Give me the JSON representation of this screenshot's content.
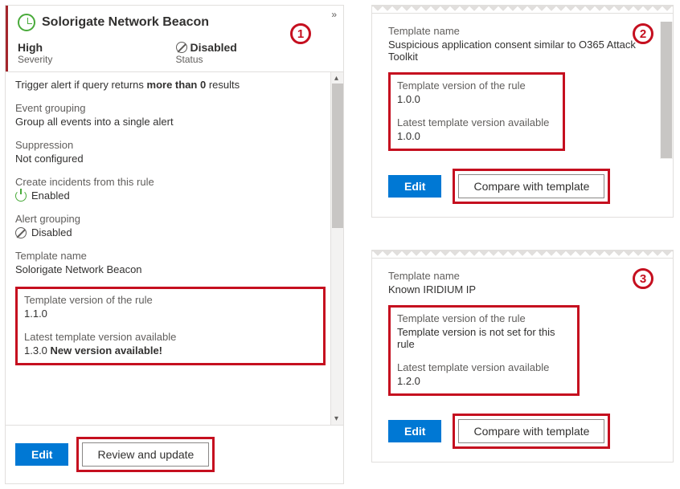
{
  "panel1": {
    "marker": "1",
    "title": "Solorigate Network Beacon",
    "severity_label": "Severity",
    "severity_value": "High",
    "status_label": "Status",
    "status_value": "Disabled",
    "trigger_prefix": "Trigger alert if query returns ",
    "trigger_bold": "more than 0",
    "trigger_suffix": " results",
    "sections": {
      "event_grouping_label": "Event grouping",
      "event_grouping_value": "Group all events into a single alert",
      "suppression_label": "Suppression",
      "suppression_value": "Not configured",
      "create_incidents_label": "Create incidents from this rule",
      "create_incidents_value": "Enabled",
      "alert_grouping_label": "Alert grouping",
      "alert_grouping_value": "Disabled",
      "template_name_label": "Template name",
      "template_name_value": "Solorigate Network Beacon"
    },
    "versions": {
      "rule_version_label": "Template version of the rule",
      "rule_version_value": "1.1.0",
      "latest_label": "Latest template version available",
      "latest_value": "1.3.0",
      "new_version_text": "New version available!"
    },
    "buttons": {
      "edit": "Edit",
      "review": "Review and update"
    }
  },
  "panel2": {
    "marker": "2",
    "template_name_label": "Template name",
    "template_name_value": "Suspicious application consent similar to O365 Attack Toolkit",
    "rule_version_label": "Template version of the rule",
    "rule_version_value": "1.0.0",
    "latest_label": "Latest template version available",
    "latest_value": "1.0.0",
    "buttons": {
      "edit": "Edit",
      "compare": "Compare with template"
    }
  },
  "panel3": {
    "marker": "3",
    "template_name_label": "Template name",
    "template_name_value": "Known IRIDIUM IP",
    "rule_version_label": "Template version of the rule",
    "rule_version_value": "Template version is not set for this rule",
    "latest_label": "Latest template version available",
    "latest_value": "1.2.0",
    "buttons": {
      "edit": "Edit",
      "compare": "Compare with template"
    }
  }
}
